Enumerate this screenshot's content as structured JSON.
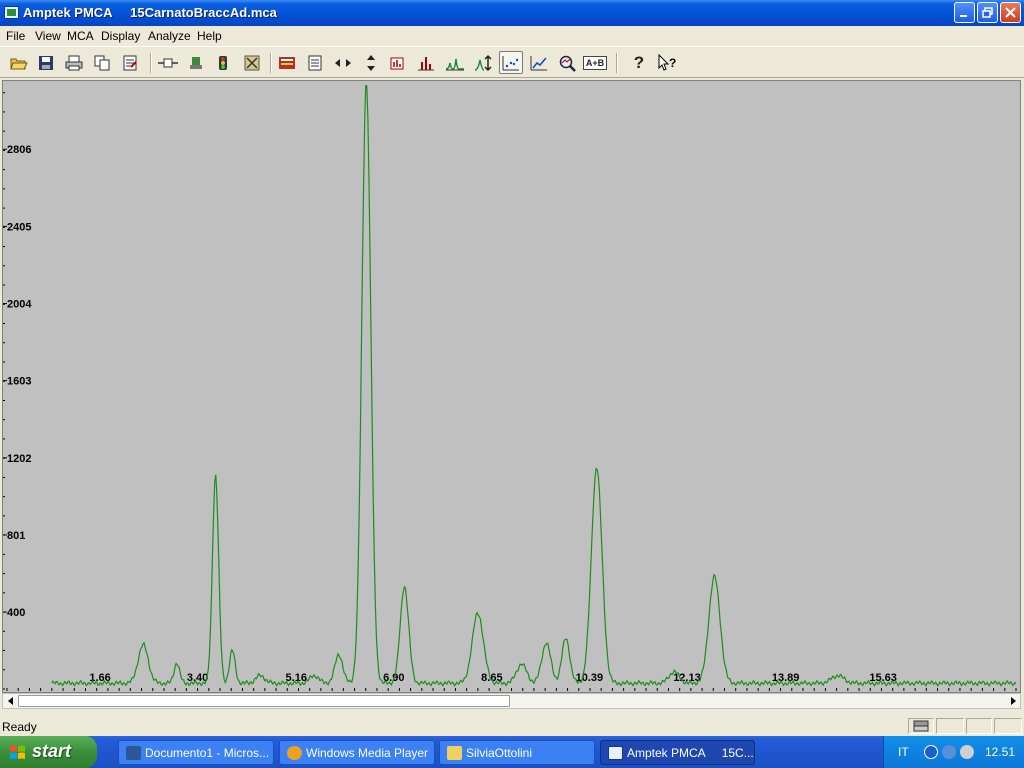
{
  "window": {
    "app_name": "Amptek PMCA",
    "file_name": "15CarnatoBraccAd.mca"
  },
  "menu": [
    "File",
    "View",
    "MCA",
    "Display",
    "Analyze",
    "Help"
  ],
  "toolbar_icons": [
    "open-icon",
    "save-icon",
    "print-icon",
    "copy-icon",
    "properties-icon",
    "acquire-setup-icon",
    "start-acquisition-icon",
    "stop-acquisition-icon",
    "delete-data-icon",
    "color-settings-icon",
    "report-icon",
    "horizontal-zoom-icon",
    "vertical-zoom-icon",
    "roi-icon",
    "bar-mode-icon",
    "peak-icon",
    "log-scale-icon",
    "point-mode-icon",
    "line-mode-icon",
    "zoom-magnifier-icon",
    "a-plus-b-icon",
    "help-icon",
    "context-help-icon"
  ],
  "toolbar_text": {
    "a_plus_b": "A+B",
    "help": "?"
  },
  "status": {
    "text": "Ready"
  },
  "taskbar": {
    "start_label": "start",
    "tasks": [
      {
        "label": "Documento1 - Micros...",
        "icon": "word-icon"
      },
      {
        "label": "Windows Media Player",
        "icon": "media-player-icon"
      },
      {
        "label": "SilviaOttolini",
        "icon": "folder-icon"
      },
      {
        "label": "Amptek PMCA     15C...",
        "icon": "pmca-icon"
      }
    ],
    "language": "IT",
    "clock": "12.51"
  },
  "colors": {
    "spectrum": "#1f8c1f",
    "plot_background": "#c0c0c0"
  },
  "chart_data": {
    "type": "line",
    "title": "",
    "xlabel": "",
    "ylabel": "",
    "x_tick_labels": [
      "1.66",
      "3.40",
      "5.16",
      "6.90",
      "8.65",
      "10.39",
      "12.13",
      "13.89",
      "15.63"
    ],
    "y_tick_labels": [
      "400",
      "801",
      "1202",
      "1603",
      "2004",
      "2405",
      "2806"
    ],
    "ylim": [
      0,
      3140
    ],
    "xlim": [
      0.0,
      18.0
    ],
    "grid": false,
    "series": [
      {
        "name": "",
        "peaks": [
          {
            "x": 2.43,
            "y": 200,
            "width": 0.09
          },
          {
            "x": 3.03,
            "y": 105,
            "width": 0.05
          },
          {
            "x": 3.72,
            "y": 1085,
            "width": 0.055
          },
          {
            "x": 4.02,
            "y": 170,
            "width": 0.05
          },
          {
            "x": 4.52,
            "y": 40,
            "width": 0.08
          },
          {
            "x": 5.48,
            "y": 40,
            "width": 0.08
          },
          {
            "x": 5.92,
            "y": 150,
            "width": 0.07
          },
          {
            "x": 6.41,
            "y": 3130,
            "width": 0.08
          },
          {
            "x": 7.09,
            "y": 505,
            "width": 0.075
          },
          {
            "x": 8.4,
            "y": 365,
            "width": 0.1
          },
          {
            "x": 9.18,
            "y": 100,
            "width": 0.09
          },
          {
            "x": 9.62,
            "y": 210,
            "width": 0.08
          },
          {
            "x": 9.97,
            "y": 235,
            "width": 0.07
          },
          {
            "x": 10.52,
            "y": 1125,
            "width": 0.095
          },
          {
            "x": 11.9,
            "y": 60,
            "width": 0.09
          },
          {
            "x": 12.62,
            "y": 555,
            "width": 0.1
          },
          {
            "x": 14.82,
            "y": 40,
            "width": 0.11
          }
        ],
        "baseline": 30
      }
    ]
  }
}
